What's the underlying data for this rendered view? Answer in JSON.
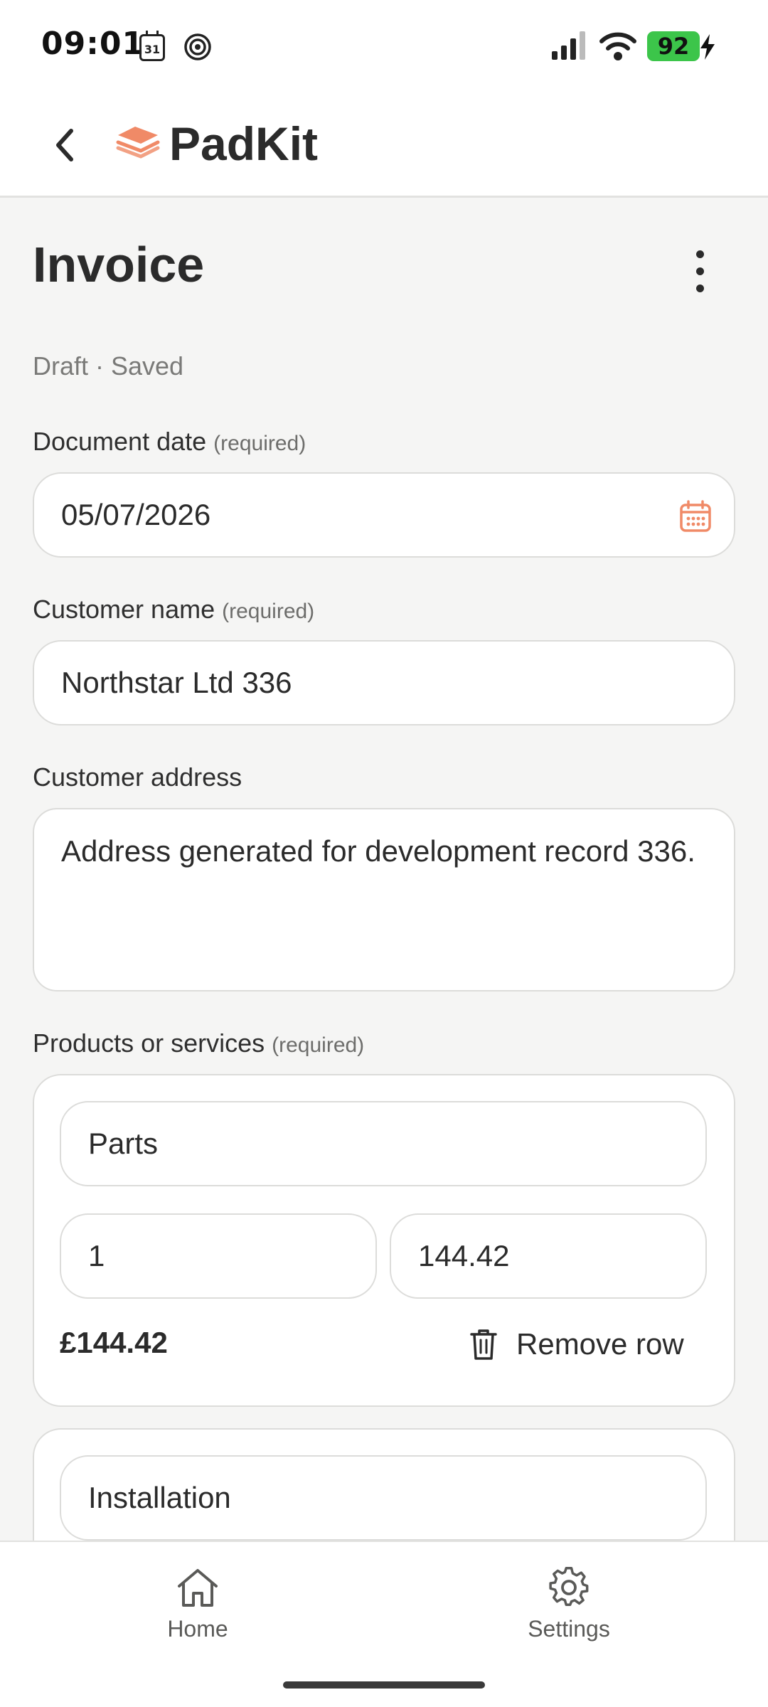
{
  "status_bar": {
    "time": "09:01",
    "calendar_day": "31",
    "battery": "92"
  },
  "app_bar": {
    "brand": "PadKit",
    "accent_color": "#f08a67"
  },
  "page": {
    "title": "Invoice",
    "status": "Draft · Saved"
  },
  "form": {
    "document_date": {
      "label": "Document date",
      "required": "(required)",
      "value": "05/07/2026"
    },
    "customer_name": {
      "label": "Customer name",
      "required": "(required)",
      "value": "Northstar Ltd 336"
    },
    "customer_address": {
      "label": "Customer address",
      "value": "Address generated for development record 336."
    },
    "products": {
      "label": "Products or services",
      "required": "(required)",
      "items": [
        {
          "description": "Parts",
          "quantity": "1",
          "price": "144.42",
          "total": "£144.42",
          "remove_label": "Remove row"
        },
        {
          "description": "Installation"
        }
      ]
    }
  },
  "bottom_nav": {
    "home": "Home",
    "settings": "Settings"
  }
}
